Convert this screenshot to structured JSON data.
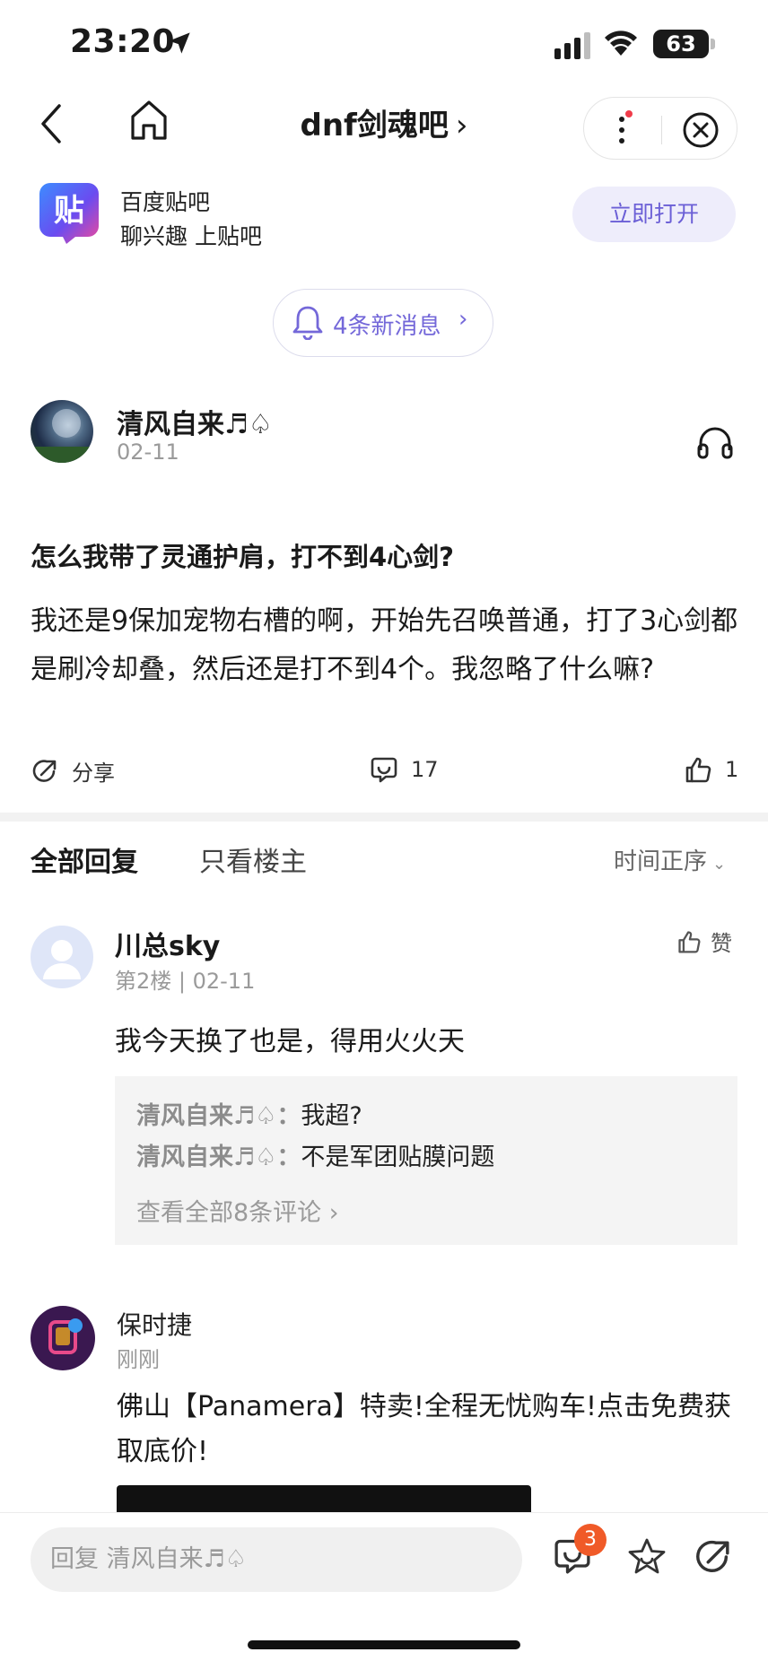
{
  "status": {
    "time": "23:20",
    "battery": "63"
  },
  "nav": {
    "title": "dnf剑魂吧",
    "title_chevron": "›"
  },
  "promo": {
    "app_name": "百度贴吧",
    "slogan": "聊兴趣 上贴吧",
    "open_button": "立即打开",
    "logo_char": "贴"
  },
  "notifications": {
    "label": "4条新消息",
    "chevron": "›"
  },
  "post": {
    "author": "清风自来♬♤",
    "date": "02-11",
    "title": "怎么我带了灵通护肩，打不到4心剑?",
    "body": "我还是9保加宠物右槽的啊，开始先召唤普通，打了3心剑都是刷冷却叠，然后还是打不到4个。我忽略了什么嘛?",
    "share_label": "分享",
    "comment_count": "17",
    "like_count": "1"
  },
  "tabs": {
    "all": "全部回复",
    "op_only": "只看楼主",
    "sort": "时间正序",
    "sort_chevron": "⌄"
  },
  "reply": {
    "name": "川总sky",
    "meta": "第2楼 | 02-11",
    "like_label": "赞",
    "text": "我今天换了也是，得用火火天",
    "sub_comments": [
      {
        "who": "清风自来♬♤：",
        "text": "我超?"
      },
      {
        "who": "清风自来♬♤：",
        "text": "不是军团贴膜问题"
      }
    ],
    "view_all": "查看全部8条评论  ›"
  },
  "ad": {
    "name": "保时捷",
    "time": "刚刚",
    "text": "佛山【Panamera】特卖!全程无忧购车!点击免费获取底价!"
  },
  "bottom": {
    "reply_placeholder": "回复 清风自来♬♤",
    "comment_badge": "3"
  }
}
